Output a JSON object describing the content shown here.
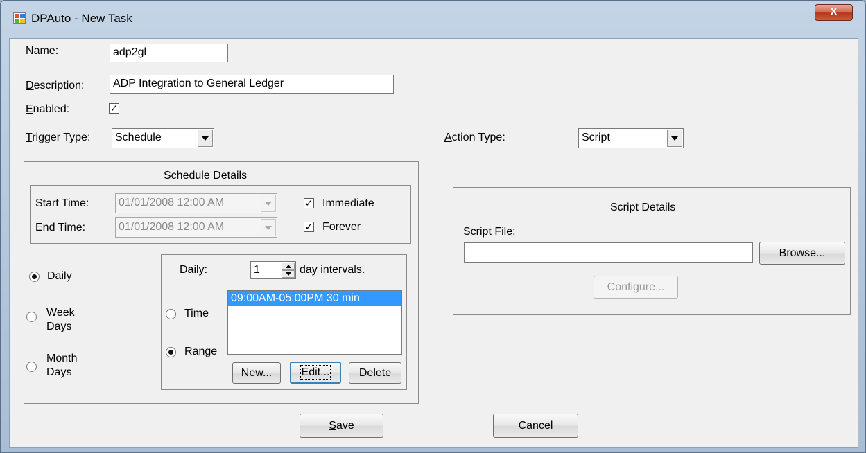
{
  "window": {
    "title": "DPAuto - New Task",
    "close_label": "X"
  },
  "form": {
    "name_label": "Name:",
    "name_value": "adp2gl",
    "description_label": "Description:",
    "description_value": "ADP Integration to General Ledger",
    "enabled_label": "Enabled:",
    "enabled_checked": true,
    "trigger_type_label": "Trigger Type:",
    "trigger_type_value": "Schedule",
    "action_type_label": "Action Type:",
    "action_type_value": "Script"
  },
  "schedule": {
    "title": "Schedule Details",
    "start_time_label": "Start Time:",
    "start_time_value": "01/01/2008 12:00 AM",
    "end_time_label": "End Time:",
    "end_time_value": "01/01/2008 12:00 AM",
    "immediate_label": "Immediate",
    "immediate_checked": true,
    "forever_label": "Forever",
    "forever_checked": true,
    "frequency": [
      {
        "label": "Daily",
        "checked": true
      },
      {
        "label": "Week Days",
        "checked": false
      },
      {
        "label": "Month Days",
        "checked": false
      }
    ],
    "daily_label": "Daily:",
    "interval_value": "1",
    "interval_suffix": "day intervals.",
    "time_label": "Time",
    "range_label": "Range",
    "time_checked": false,
    "range_checked": true,
    "ranges": [
      "09:00AM-05:00PM 30 min"
    ],
    "new_label": "New...",
    "edit_label": "Edit...",
    "delete_label": "Delete"
  },
  "script": {
    "title": "Script Details",
    "script_file_label": "Script File:",
    "script_file_value": "",
    "browse_label": "Browse...",
    "configure_label": "Configure..."
  },
  "footer": {
    "save_label": "Save",
    "cancel_label": "Cancel"
  },
  "icons": {
    "app": "app-icon",
    "check": "✓"
  },
  "colors": {
    "selection": "#3399ff",
    "title_gradient": "#b6c9dd",
    "close": "#c8442a"
  }
}
